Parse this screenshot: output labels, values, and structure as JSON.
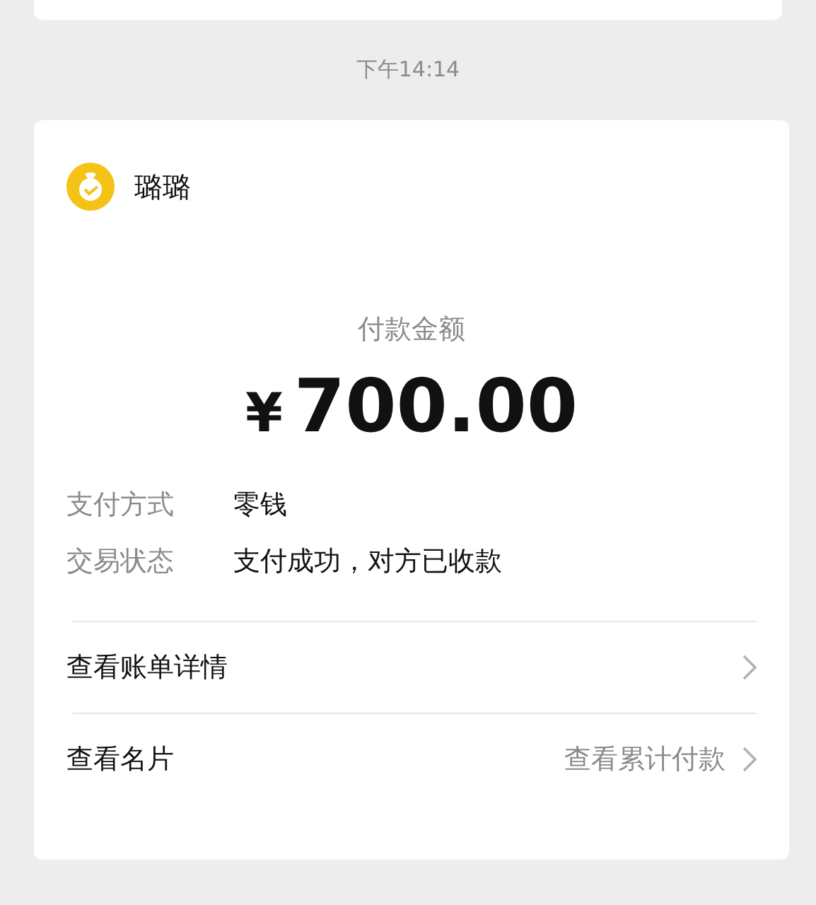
{
  "timestamp": "下午14:14",
  "payee": {
    "name": "璐璐"
  },
  "amount_label": "付款金额",
  "amount": {
    "currency": "¥",
    "value": "700.00"
  },
  "details": [
    {
      "label": "支付方式",
      "value": "零钱"
    },
    {
      "label": "交易状态",
      "value": "支付成功，对方已收款"
    }
  ],
  "links": [
    {
      "label": "查看账单详情"
    },
    {
      "label": "查看名片",
      "value": "查看累计付款"
    }
  ]
}
